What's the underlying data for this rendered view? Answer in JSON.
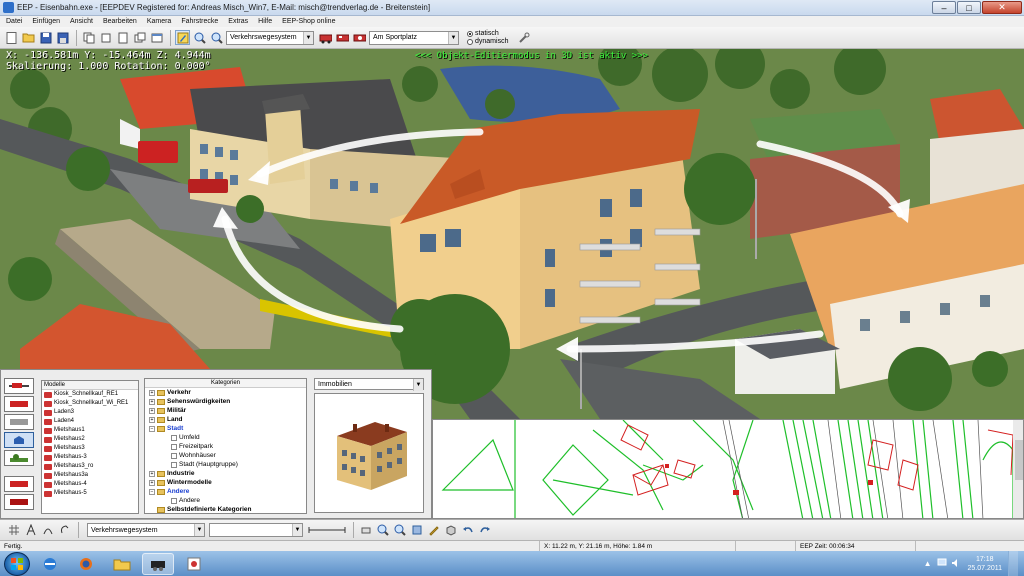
{
  "window": {
    "title": "EEP - Eisenbahn.exe - [EEPDEV Registered for: Andreas Misch_Win7, E-Mail: misch@trendverlag.de - Breitenstein]",
    "minimize": "–",
    "maximize": "□",
    "close": "✕"
  },
  "menu": [
    "Datei",
    "Einfügen",
    "Ansicht",
    "Bearbeiten",
    "Kamera",
    "Fahrstrecke",
    "Extras",
    "Hilfe",
    "EEP-Shop online"
  ],
  "toolbar": {
    "track_system": "Verkehrswegesystem",
    "location": "Am Sportplatz",
    "radio_static": "statisch",
    "radio_dynamic": "dynamisch"
  },
  "viewport": {
    "coord_line1": "X: -136.581m Y: -15.464m Z: 4.944m",
    "coord_line2": "Skalierung: 1.000 Rotation: 0.000°",
    "edit_mode": "<<< Objekt-Editiermodus in 3D ist aktiv >>>"
  },
  "models_panel": {
    "header": "Modelle",
    "items": [
      "Kiosk_Schnellkauf_RE1",
      "Kiosk_Schnellkauf_Wi_RE1",
      "Laden3",
      "Laden4",
      "Mietshaus1",
      "Mietshaus2",
      "Mietshaus3",
      "Mietshaus-3",
      "Mietshaus3_ro",
      "Mietshaus3a",
      "Mietshaus-4",
      "Mietshaus-5"
    ]
  },
  "categories_panel": {
    "header": "Kategorien",
    "rows": [
      {
        "label": "Verkehr",
        "level": 0,
        "bold": true,
        "blue": false,
        "exp": "+"
      },
      {
        "label": "Sehenswürdigkeiten",
        "level": 0,
        "bold": true,
        "blue": false,
        "exp": "+"
      },
      {
        "label": "Militär",
        "level": 0,
        "bold": true,
        "blue": false,
        "exp": "+"
      },
      {
        "label": "Land",
        "level": 0,
        "bold": true,
        "blue": false,
        "exp": "+"
      },
      {
        "label": "Stadt",
        "level": 0,
        "bold": true,
        "blue": true,
        "exp": "−"
      },
      {
        "label": "Umfeld",
        "level": 1,
        "bold": false,
        "blue": false,
        "exp": ""
      },
      {
        "label": "Freizeitpark",
        "level": 1,
        "bold": false,
        "blue": false,
        "exp": ""
      },
      {
        "label": "Wohnhäuser",
        "level": 1,
        "bold": false,
        "blue": false,
        "exp": ""
      },
      {
        "label": "Stadt (Hauptgruppe)",
        "level": 1,
        "bold": false,
        "blue": false,
        "exp": ""
      },
      {
        "label": "Industrie",
        "level": 0,
        "bold": true,
        "blue": false,
        "exp": "+"
      },
      {
        "label": "Wintermodelle",
        "level": 0,
        "bold": true,
        "blue": false,
        "exp": "+"
      },
      {
        "label": "Andere",
        "level": 0,
        "bold": true,
        "blue": true,
        "exp": "−"
      },
      {
        "label": "Andere",
        "level": 1,
        "bold": false,
        "blue": false,
        "exp": ""
      },
      {
        "label": "Selbstdefinierte Kategorien",
        "level": 0,
        "bold": true,
        "blue": false,
        "exp": ""
      },
      {
        "label": "Zeitabschnitte",
        "level": 0,
        "bold": true,
        "blue": false,
        "exp": "+"
      }
    ]
  },
  "preview": {
    "category": "Immobilien"
  },
  "lower_toolbar": {
    "track_system": "Verkehrswegesystem"
  },
  "statusbar": {
    "status": "Fertig.",
    "position": "X: 11.22 m, Y: 21.16 m, Höhe: 1.84 m",
    "eep_time": "EEP Zeit: 00:06:34"
  },
  "taskbar": {
    "time": "17:18",
    "date": "25.07.2011"
  },
  "colors": {
    "track_green": "#1fbf2a",
    "signal_red": "#d42020",
    "edit_mode_green": "#3bf23b"
  }
}
